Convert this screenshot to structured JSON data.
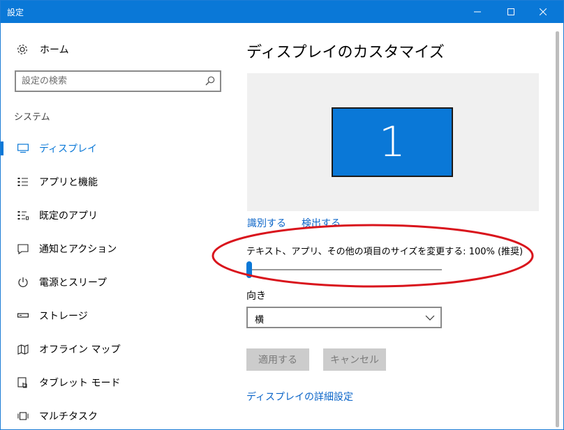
{
  "window": {
    "title": "設定"
  },
  "sidebar": {
    "home_label": "ホーム",
    "search_placeholder": "設定の検索",
    "section_label": "システム",
    "items": [
      {
        "label": "ディスプレイ",
        "icon": "monitor-icon",
        "active": true
      },
      {
        "label": "アプリと機能",
        "icon": "apps-list-icon",
        "active": false
      },
      {
        "label": "既定のアプリ",
        "icon": "default-apps-icon",
        "active": false
      },
      {
        "label": "通知とアクション",
        "icon": "notification-icon",
        "active": false
      },
      {
        "label": "電源とスリープ",
        "icon": "power-icon",
        "active": false
      },
      {
        "label": "ストレージ",
        "icon": "storage-icon",
        "active": false
      },
      {
        "label": "オフライン マップ",
        "icon": "map-icon",
        "active": false
      },
      {
        "label": "タブレット モード",
        "icon": "tablet-mode-icon",
        "active": false
      },
      {
        "label": "マルチタスク",
        "icon": "multitask-icon",
        "active": false
      }
    ]
  },
  "main": {
    "title": "ディスプレイのカスタマイズ",
    "monitor_number": "1",
    "identify_link": "識別する",
    "detect_link": "検出する",
    "scale_label": "テキスト、アプリ、その他の項目のサイズを変更する: 100% (推奨)",
    "scale_slider_fraction": 0.0,
    "orientation_label": "向き",
    "orientation_value": "横",
    "apply_button": "適用する",
    "cancel_button": "キャンセル",
    "advanced_link": "ディスプレイの詳細設定"
  },
  "colors": {
    "accent": "#0a78d7",
    "annotation": "#d9141c"
  }
}
